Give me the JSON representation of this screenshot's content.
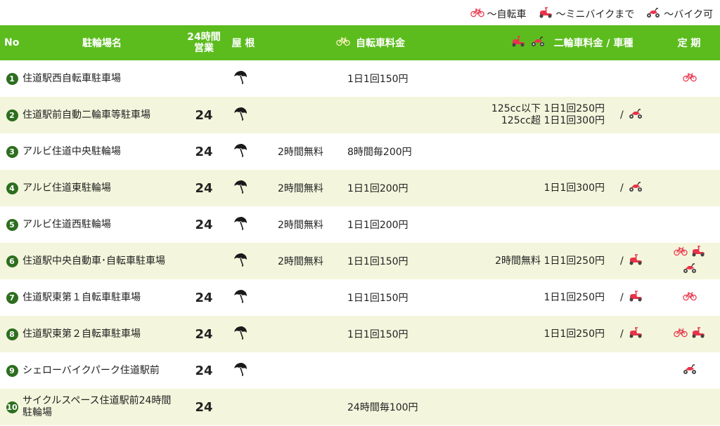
{
  "legend": [
    {
      "icon": "bicycle-icon",
      "label": "〜自転車"
    },
    {
      "icon": "scooter-icon",
      "label": "〜ミニバイクまで"
    },
    {
      "icon": "motorbike-icon",
      "label": "〜バイク可"
    }
  ],
  "header": {
    "no": "No",
    "name": "駐輪場名",
    "h24_line1": "24時間",
    "h24_line2": "営業",
    "roof": "屋 根",
    "bicycle_fee": "自転車料金",
    "moto_fee": "二輪車料金 / 車種",
    "pass": "定 期"
  },
  "colors": {
    "header_bg": "#5cbc1e",
    "alt_row_bg": "#f3f6dc",
    "number_badge": "#2d6e1f",
    "vehicle_red": "#e8334a"
  },
  "rows": [
    {
      "no": "1",
      "name": "住道駅西自転車駐車場",
      "h24": "",
      "roof": true,
      "free": "",
      "bicycle_fee": "1日1回150円",
      "moto_fee": [],
      "moto_type": [],
      "pass": [
        "bicycle-icon"
      ]
    },
    {
      "no": "2",
      "name": "住道駅前自動二輪車等駐車場",
      "h24": "24",
      "roof": true,
      "free": "",
      "bicycle_fee": "",
      "moto_fee": [
        "125cc以下 1日1回250円",
        "125cc超 1日1回300円"
      ],
      "moto_type": [
        "motorbike-icon"
      ],
      "pass": []
    },
    {
      "no": "3",
      "name": "アルビ住道中央駐輪場",
      "h24": "24",
      "roof": true,
      "free": "2時間無料",
      "bicycle_fee": "8時間毎200円",
      "moto_fee": [],
      "moto_type": [],
      "pass": []
    },
    {
      "no": "4",
      "name": "アルビ住道東駐輪場",
      "h24": "24",
      "roof": true,
      "free": "2時間無料",
      "bicycle_fee": "1日1回200円",
      "moto_fee": [
        "1日1回300円"
      ],
      "moto_type": [
        "motorbike-icon"
      ],
      "pass": []
    },
    {
      "no": "5",
      "name": "アルビ住道西駐輪場",
      "h24": "24",
      "roof": true,
      "free": "2時間無料",
      "bicycle_fee": "1日1回200円",
      "moto_fee": [],
      "moto_type": [],
      "pass": []
    },
    {
      "no": "6",
      "name": "住道駅中央自動車･自転車駐車場",
      "h24": "",
      "roof": true,
      "free": "2時間無料",
      "bicycle_fee": "1日1回150円",
      "moto_fee": [
        "2時間無料  1日1回250円"
      ],
      "moto_type": [
        "scooter-icon"
      ],
      "pass": [
        "bicycle-icon",
        "scooter-icon",
        "motorbike-icon"
      ]
    },
    {
      "no": "7",
      "name": "住道駅東第１自転車駐車場",
      "h24": "24",
      "roof": true,
      "free": "",
      "bicycle_fee": "1日1回150円",
      "moto_fee": [
        "1日1回250円"
      ],
      "moto_type": [
        "scooter-icon"
      ],
      "pass": [
        "bicycle-icon"
      ]
    },
    {
      "no": "8",
      "name": "住道駅東第２自転車駐車場",
      "h24": "24",
      "roof": true,
      "free": "",
      "bicycle_fee": "1日1回150円",
      "moto_fee": [
        "1日1回250円"
      ],
      "moto_type": [
        "scooter-icon"
      ],
      "pass": [
        "bicycle-icon",
        "scooter-icon"
      ]
    },
    {
      "no": "9",
      "name": "シェローバイクパーク住道駅前",
      "h24": "24",
      "roof": true,
      "free": "",
      "bicycle_fee": "",
      "moto_fee": [],
      "moto_type": [],
      "pass": [
        "motorbike-icon"
      ]
    },
    {
      "no": "10",
      "name": "サイクルスペース住道駅前24時間駐輪場",
      "h24": "24",
      "roof": false,
      "free": "",
      "bicycle_fee": "24時間毎100円",
      "moto_fee": [],
      "moto_type": [],
      "pass": []
    }
  ]
}
